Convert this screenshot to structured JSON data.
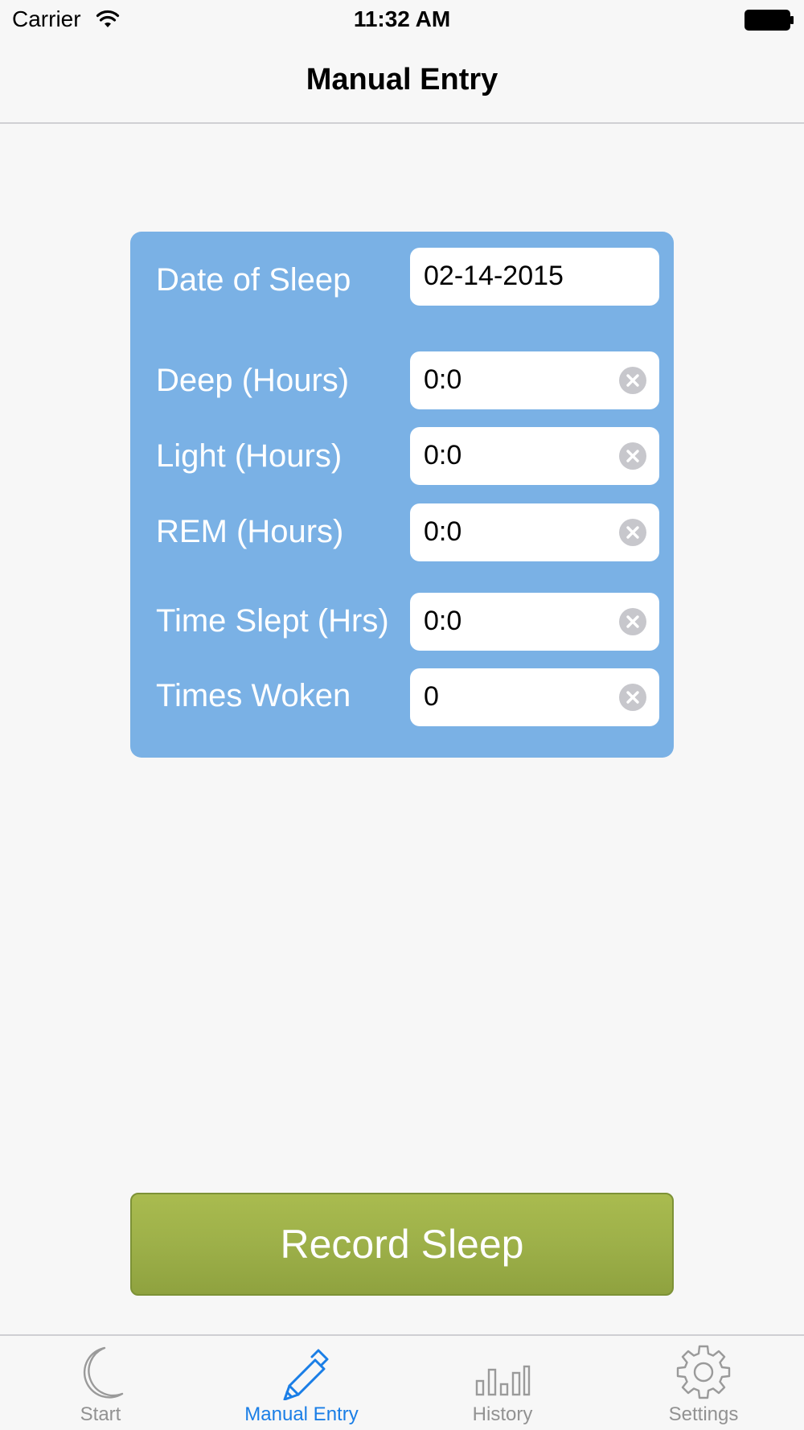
{
  "status_bar": {
    "carrier": "Carrier",
    "time": "11:32 AM"
  },
  "nav": {
    "title": "Manual Entry"
  },
  "form": {
    "fields": [
      {
        "label": "Date of Sleep",
        "value": "02-14-2015",
        "clearable": false
      },
      {
        "label": "Deep (Hours)",
        "value": "0:0",
        "clearable": true
      },
      {
        "label": "Light (Hours)",
        "value": "0:0",
        "clearable": true
      },
      {
        "label": "REM (Hours)",
        "value": "0:0",
        "clearable": true
      },
      {
        "label": "Time Slept (Hrs)",
        "value": "0:0",
        "clearable": true
      },
      {
        "label": "Times Woken",
        "value": "0",
        "clearable": true
      }
    ]
  },
  "record_button": {
    "label": "Record Sleep"
  },
  "tab_bar": {
    "items": [
      {
        "label": "Start",
        "icon": "moon-icon",
        "active": false
      },
      {
        "label": "Manual Entry",
        "icon": "pencil-icon",
        "active": true
      },
      {
        "label": "History",
        "icon": "bar-chart-icon",
        "active": false
      },
      {
        "label": "Settings",
        "icon": "gear-icon",
        "active": false
      }
    ]
  },
  "colors": {
    "panel": "#7ab1e5",
    "button": "#9db049",
    "tab_active": "#1a7ee6",
    "tab_inactive": "#929292"
  }
}
